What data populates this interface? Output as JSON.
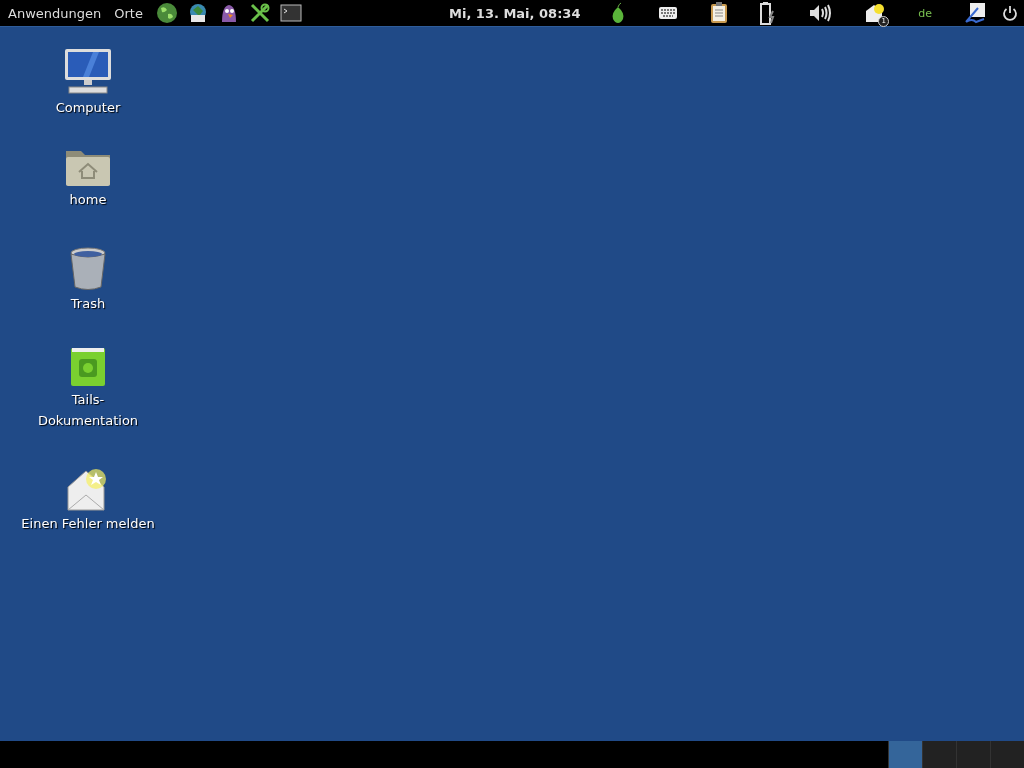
{
  "top_bar": {
    "menus": [
      "Anwendungen",
      "Orte"
    ],
    "clock": "Mi, 13. Mai, 08:34",
    "notification_count": "1",
    "keyboard_layout": "de"
  },
  "desktop_icons": [
    {
      "label": "Computer",
      "kind": "computer"
    },
    {
      "label": "home",
      "kind": "folder"
    },
    {
      "label": "Trash",
      "kind": "trash"
    },
    {
      "label": "Tails-\nDokumentation",
      "kind": "book"
    },
    {
      "label": "Einen Fehler melden",
      "kind": "mail"
    }
  ],
  "workspaces": [
    {
      "selected": true
    },
    {
      "selected": false
    },
    {
      "selected": false
    },
    {
      "selected": false
    }
  ]
}
